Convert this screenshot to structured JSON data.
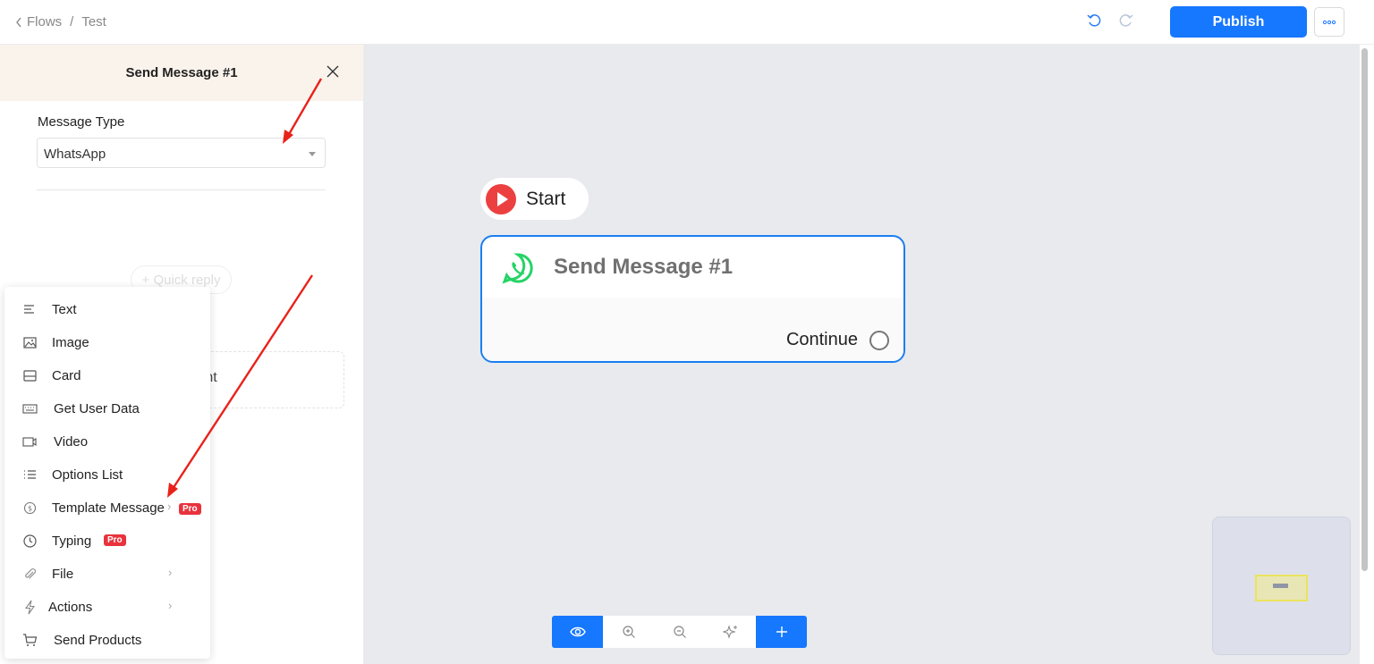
{
  "breadcrumb": {
    "back_label": "Flows",
    "separator": "/",
    "current": "Test"
  },
  "header": {
    "publish_label": "Publish",
    "more_icon": "ellipsis-icon"
  },
  "panel": {
    "title": "Send Message #1",
    "message_type_label": "Message Type",
    "message_type_value": "WhatsApp",
    "quick_reply_label": "+ Quick reply",
    "content_placeholder": "tent"
  },
  "menu": {
    "items": [
      {
        "label": "Text",
        "icon": "text-lines-icon"
      },
      {
        "label": "Image",
        "icon": "image-icon"
      },
      {
        "label": "Card",
        "icon": "card-icon"
      },
      {
        "label": "Get User Data",
        "icon": "keyboard-icon"
      },
      {
        "label": "Video",
        "icon": "video-icon"
      },
      {
        "label": "Options List",
        "icon": "list-icon"
      },
      {
        "label": "Template Message",
        "icon": "dollar-circle-icon",
        "badge": "Pro",
        "has_submenu": true
      },
      {
        "label": "Typing",
        "icon": "clock-icon",
        "badge": "Pro"
      },
      {
        "label": "File",
        "icon": "paperclip-icon",
        "has_submenu": true
      },
      {
        "label": "Actions",
        "icon": "lightning-icon",
        "has_submenu": true
      },
      {
        "label": "Send Products",
        "icon": "cart-icon"
      }
    ]
  },
  "canvas": {
    "start_label": "Start",
    "node_title": "Send Message #1",
    "continue_label": "Continue"
  },
  "colors": {
    "accent": "#1677ff",
    "canvas_bg": "#e9eaee",
    "panel_head_bg": "#faf3ec",
    "pro_badge": "#e8333d",
    "whatsapp": "#25d366",
    "annotation_arrow": "#e8221b"
  }
}
